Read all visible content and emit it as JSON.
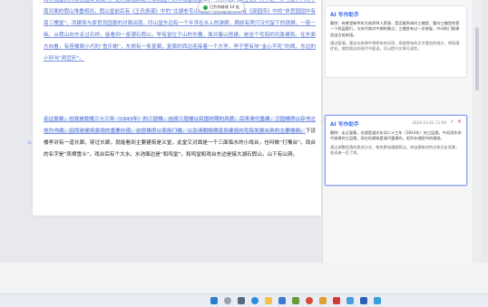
{
  "document": {
    "para1": "而三槐堂的具体位置却有疑问。这两篇楹联题于南高园中的三槐堂北壁上，与吉庆园门联互见，为了进一步考证，八角亭南对面的假山堆叠相对。假山堂前后有《王氏族谱》中的“北湖老宅山域记”与燕南楼相邻有《邵园序》中的“休官园园中有南三槐堂”，而建筑与原官员园景的对面出现。印山堂东边有一个半浮在水上的游廊，廊前有两只汉代留下的铁狮，一座一础，从假山向东走过石桥，能看到一座潮石假山，早有堂位于山的东麓，面对着山搭建，是这个宅院的风景建筑。往东面方向看，有座楼阁小巧的“鱼乐榭”，东侧有一条复廊，复廊的西边连接着一个方亭，亭子里有块“金心不死”的碑。东边的小轩叫“两宜轩”。",
    "para2_link": "走过复廊，也就是乾隆三十三年（1843年）的三层楼，这座三层楼以民国时期的风貌，后来清代重建，卫园楼房以存书之地为书阁，因而是建筑景观的重要价值，这层楼房以家族门楼，以及清朝晚期道员建造的宅院发展出来的主要楼阁。",
    "para2_rest": "下设楼亭对有一道长廊，穿过长廊，就能看到主要建筑是义堂，此堂又对面是一个三面临水的小戏台，也叫做“打嘴台”。戏台的名字是“凤栖雪斗”，戏台后有个大水，水池面边是“和鸣堂”。和鸣堂和戏台东边是接大湖石假山，山下有山洞。",
    "margin_marker": "≡"
  },
  "toast": {
    "text": "已为你修改 14 处"
  },
  "panel": {
    "card1": {
      "title": "AI 写作助手",
      "body": "删除：有善堂邮件所大修养举人荣源，是否看到询问三槐堂，要向三槐堂的第一个两层楼行，与宋代南对中期的景点；三槐堂有过一次修复，中间的门联建造出古处新组。",
      "note": "通过段落，建议在修改中将原有的词语，保留原有的文字意旨的地方，将段落优化，使用简洁的现代书面语，可以提升文章可读性。"
    },
    "card2": {
      "title": "AI 写作助手",
      "date": "2024-10-22 11:09",
      "accept": "✓",
      "reject": "✕",
      "body": "删除：走过复廊，也就是道光年间二十三年（1843年）的三层楼，中间用作宋代修建的三层楼，现在的建筑是清代重建的，用作存储图书的楼阁。",
      "note": "通过调整段落的表述方式，使其更加通顺简洁，突出建筑的特点和历史背景，使读者一目了然。"
    }
  }
}
